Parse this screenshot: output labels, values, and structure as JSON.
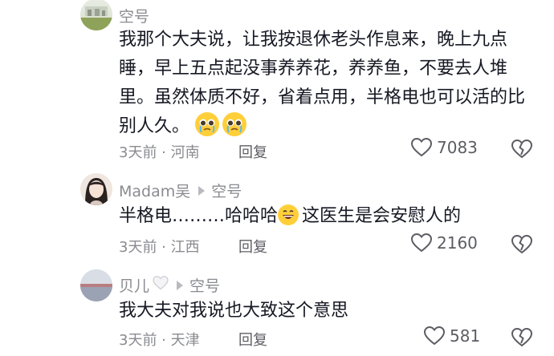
{
  "comments": [
    {
      "username": "空号",
      "text": "我那个大夫说，让我按退休老头作息来，晚上九点睡，早上五点起没事养养花，养养鱼，不要去人堆里。虽然体质不好，省着点用，半格电也可以活的比别人久。",
      "emojis": [
        "pleading-face-emoji",
        "pleading-face-emoji"
      ],
      "time_location": "3天前 · 河南",
      "reply_label": "回复",
      "likes": "7083"
    },
    {
      "username": "Madam吴",
      "reply_to": "空号",
      "text_before_emoji": "半格电………哈哈哈",
      "text_after_emoji": "这医生是会安慰人的",
      "emoji": "grinning-face-emoji",
      "time_location": "3天前 · 江西",
      "reply_label": "回复",
      "likes": "2160"
    },
    {
      "username": "贝儿",
      "username_icon": "white-heart-icon",
      "reply_to": "空号",
      "text": "我大夫对我说也大致这个意思",
      "time_location": "3天前 · 天津",
      "reply_label": "回复",
      "likes": "581"
    }
  ],
  "colors": {
    "text": "#161823",
    "meta": "#8a8b91",
    "action": "#5c5d63"
  }
}
